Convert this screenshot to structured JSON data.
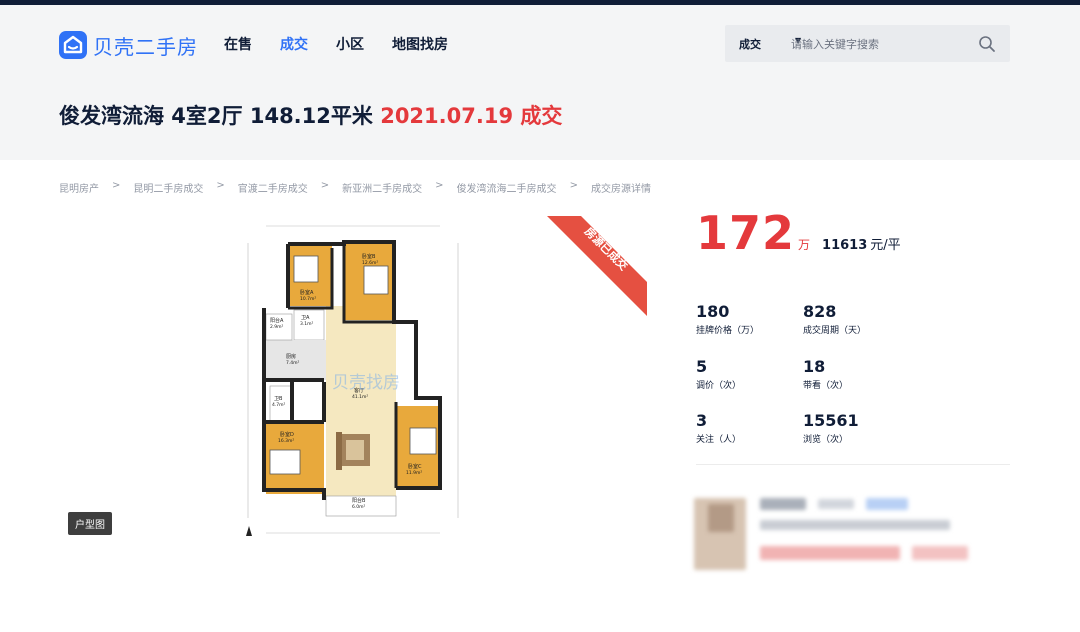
{
  "header": {
    "logo_text": "贝壳二手房",
    "nav": [
      {
        "label": "在售",
        "active": false
      },
      {
        "label": "成交",
        "active": true
      },
      {
        "label": "小区",
        "active": false
      },
      {
        "label": "地图找房",
        "active": false
      }
    ],
    "search": {
      "select_label": "成交",
      "placeholder": "请输入关键字搜索"
    }
  },
  "title": {
    "main": "俊发湾流海 4室2厅 148.12平米",
    "deal": "2021.07.19 成交"
  },
  "breadcrumb": [
    "昆明房产",
    "昆明二手房成交",
    "官渡二手房成交",
    "新亚洲二手房成交",
    "俊发湾流海二手房成交",
    "成交房源详情"
  ],
  "floorplan": {
    "badge": "户型图",
    "watermark": "贝壳找房",
    "rooms": [
      {
        "name": "卧室A",
        "area": "10.7m²"
      },
      {
        "name": "卧室B",
        "area": "12.6m²"
      },
      {
        "name": "卫A",
        "area": "3.1m²"
      },
      {
        "name": "阳台A",
        "area": "2.9m²"
      },
      {
        "name": "厨房",
        "area": "7.4m²"
      },
      {
        "name": "卫B",
        "area": "4.7m²"
      },
      {
        "name": "客厅",
        "area": "41.1m²"
      },
      {
        "name": "卧室D",
        "area": "16.3m²"
      },
      {
        "name": "卧室C",
        "area": "11.9m²"
      },
      {
        "name": "阳台B",
        "area": "6.0m²"
      }
    ],
    "sold_ribbon": "房源已成交"
  },
  "price": {
    "total": "172",
    "total_unit": "万",
    "unit_price": "11613",
    "unit_price_unit": "元/平"
  },
  "stats": [
    {
      "value": "180",
      "label": "挂牌价格（万）"
    },
    {
      "value": "828",
      "label": "成交周期（天）"
    },
    {
      "value": "5",
      "label": "调价（次）"
    },
    {
      "value": "18",
      "label": "带看（次）"
    },
    {
      "value": "3",
      "label": "关注（人）"
    },
    {
      "value": "15561",
      "label": "浏览（次）"
    }
  ],
  "colors": {
    "brand": "#3072f6",
    "accent": "#e4393c",
    "text": "#101d37",
    "header_bg": "#f4f5f6"
  }
}
